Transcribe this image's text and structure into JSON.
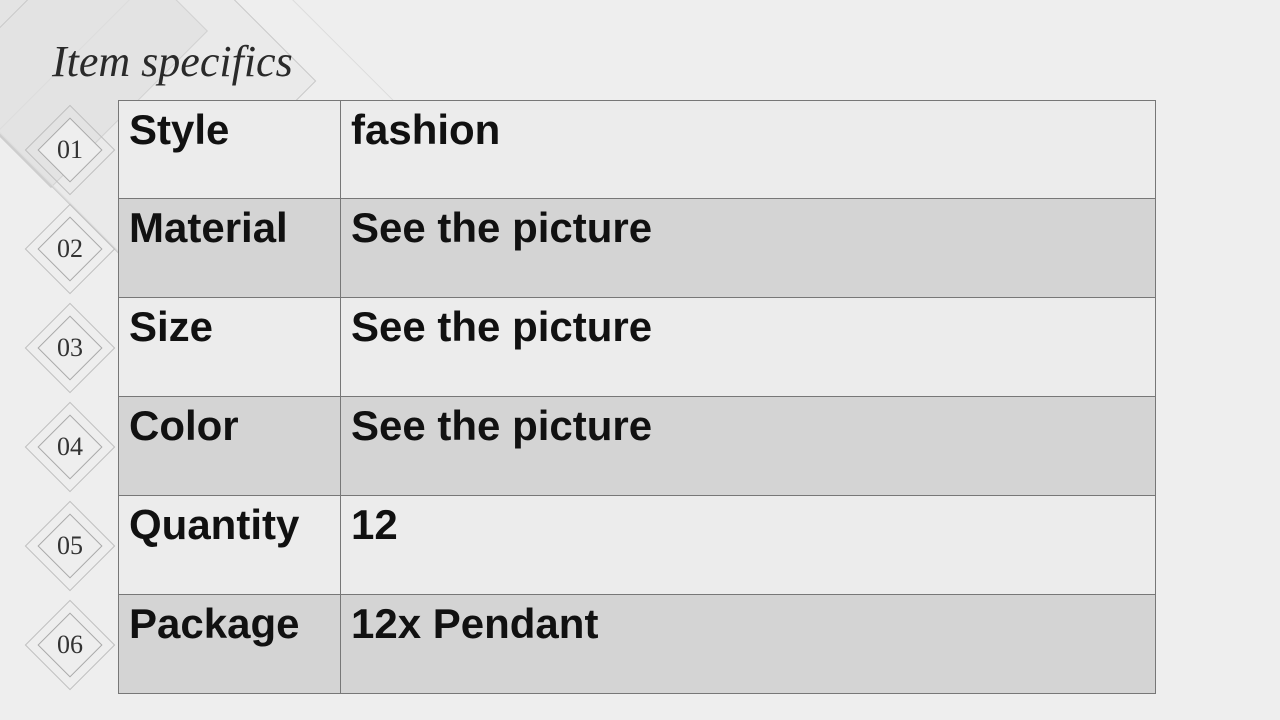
{
  "title": "Item specifics",
  "rows": [
    {
      "index": "01",
      "key": "Style",
      "value": "fashion"
    },
    {
      "index": "02",
      "key": "Material",
      "value": "See the picture"
    },
    {
      "index": "03",
      "key": "Size",
      "value": "See the picture"
    },
    {
      "index": "04",
      "key": "Color",
      "value": "See the picture"
    },
    {
      "index": "05",
      "key": "Quantity",
      "value": "12"
    },
    {
      "index": "06",
      "key": "Package",
      "value": "12x Pendant"
    }
  ]
}
